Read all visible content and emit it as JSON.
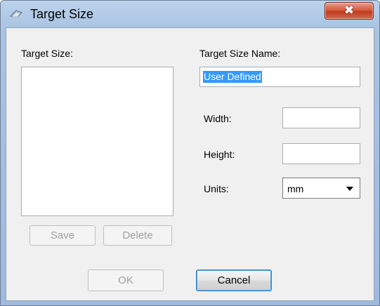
{
  "window": {
    "title": "Target Size",
    "close_glyph": "✖",
    "app_icon": "scanner-app-icon"
  },
  "left_panel": {
    "list_label": "Target Size:",
    "items": [],
    "save_label": "Save",
    "delete_label": "Delete"
  },
  "right_panel": {
    "name_label": "Target Size Name:",
    "name_value": "User Defined",
    "width_label": "Width:",
    "width_value": "",
    "height_label": "Height:",
    "height_value": "",
    "units_label": "Units:",
    "units_selected": "mm"
  },
  "footer": {
    "ok_label": "OK",
    "cancel_label": "Cancel"
  },
  "colors": {
    "title_bar": "#a9c3e3",
    "close_button": "#c23b1f",
    "selection": "#3399ff",
    "dialog_bg": "#f0f0f0"
  }
}
